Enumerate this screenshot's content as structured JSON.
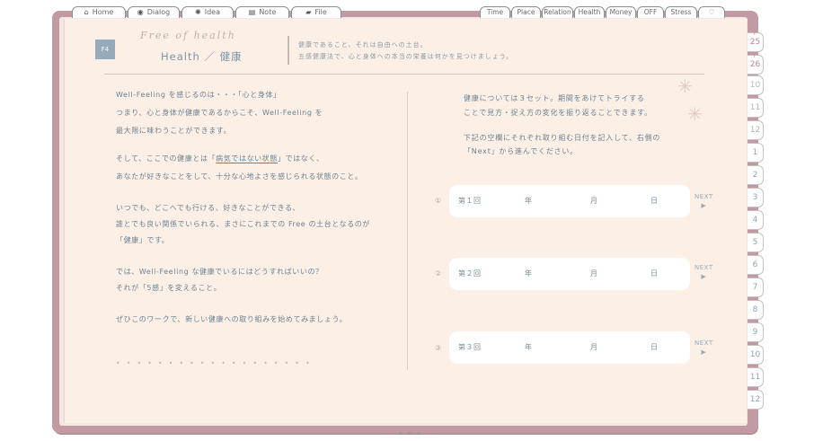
{
  "nav_tabs": [
    {
      "label": "Home",
      "icon": "home-icon"
    },
    {
      "label": "Dialog",
      "icon": "dialog-icon"
    },
    {
      "label": "Idea",
      "icon": "bulb-icon"
    },
    {
      "label": "Note",
      "icon": "note-icon"
    },
    {
      "label": "File",
      "icon": "folder-icon"
    }
  ],
  "category_tabs": [
    "Time",
    "Place",
    "Relation",
    "Health",
    "Money",
    "OFF",
    "Stress",
    "heart"
  ],
  "side_tabs": [
    {
      "label": "25",
      "year": "Y"
    },
    {
      "label": "26",
      "year": "Y"
    },
    {
      "label": "10"
    },
    {
      "label": "11"
    },
    {
      "label": "12"
    },
    {
      "label": "1"
    },
    {
      "label": "2"
    },
    {
      "label": "3"
    },
    {
      "label": "4"
    },
    {
      "label": "5"
    },
    {
      "label": "6"
    },
    {
      "label": "7"
    },
    {
      "label": "8"
    },
    {
      "label": "9"
    },
    {
      "label": "10"
    },
    {
      "label": "11"
    },
    {
      "label": "12"
    }
  ],
  "header": {
    "badge": "F4",
    "script_title": "Free of health",
    "title": "Health ／ 健康",
    "desc_line1": "健康であること、それは自由への土台。",
    "desc_line2": "五感健康法で、心と身体への本当の栄養は何かを見つけましょう。"
  },
  "left": {
    "l1": "Well-Feeling を感じるのは・・・「心と身体」",
    "l2": "つまり、心と身体が健康であるからこそ、Well-Feeling を",
    "l3": "最大限に味わうことができます。",
    "l4_pre": "そして、ここでの健康とは「",
    "l4_ul": "病気ではない状態",
    "l4_post": "」ではなく、",
    "l5": "あなたが好きなことをして、十分な心地よさを感じられる状態のこと。",
    "l6": "いつでも、どこへでも行ける、好きなことができる、",
    "l7": "誰とでも良い関係でいられる、まさにこれまでの Free の土台となるのが",
    "l8": "「健康」です。",
    "l9": "では、Well-Feeling な健康でいるにはどうすればいいの？",
    "l10": "それが「5感」を変えること。",
    "l11": "ぜひこのワークで、新しい健康への取り組みを始めてみましょう。"
  },
  "right": {
    "r1": "健康については３セット。期間をあけてトライする",
    "r2": "ことで見方・捉え方の変化を振り返ることできます。",
    "r3": "下記の空欄にそれぞれ取り組む日付を記入して、右側の",
    "r4": "「Next」から進んでください。"
  },
  "entries": [
    {
      "num": "①",
      "label": "第１回",
      "year": "年",
      "month": "月",
      "day": "日",
      "next": "NEXT",
      "arrow": "▶"
    },
    {
      "num": "②",
      "label": "第２回",
      "year": "年",
      "month": "月",
      "day": "日",
      "next": "NEXT",
      "arrow": "▶"
    },
    {
      "num": "③",
      "label": "第３回",
      "year": "年",
      "month": "月",
      "day": "日",
      "next": "NEXT",
      "arrow": "▶"
    }
  ],
  "colors": {
    "cover": "#c29aa3",
    "paper": "#fcefe6",
    "accent_text": "#6b8292",
    "badge": "#97aab9"
  }
}
